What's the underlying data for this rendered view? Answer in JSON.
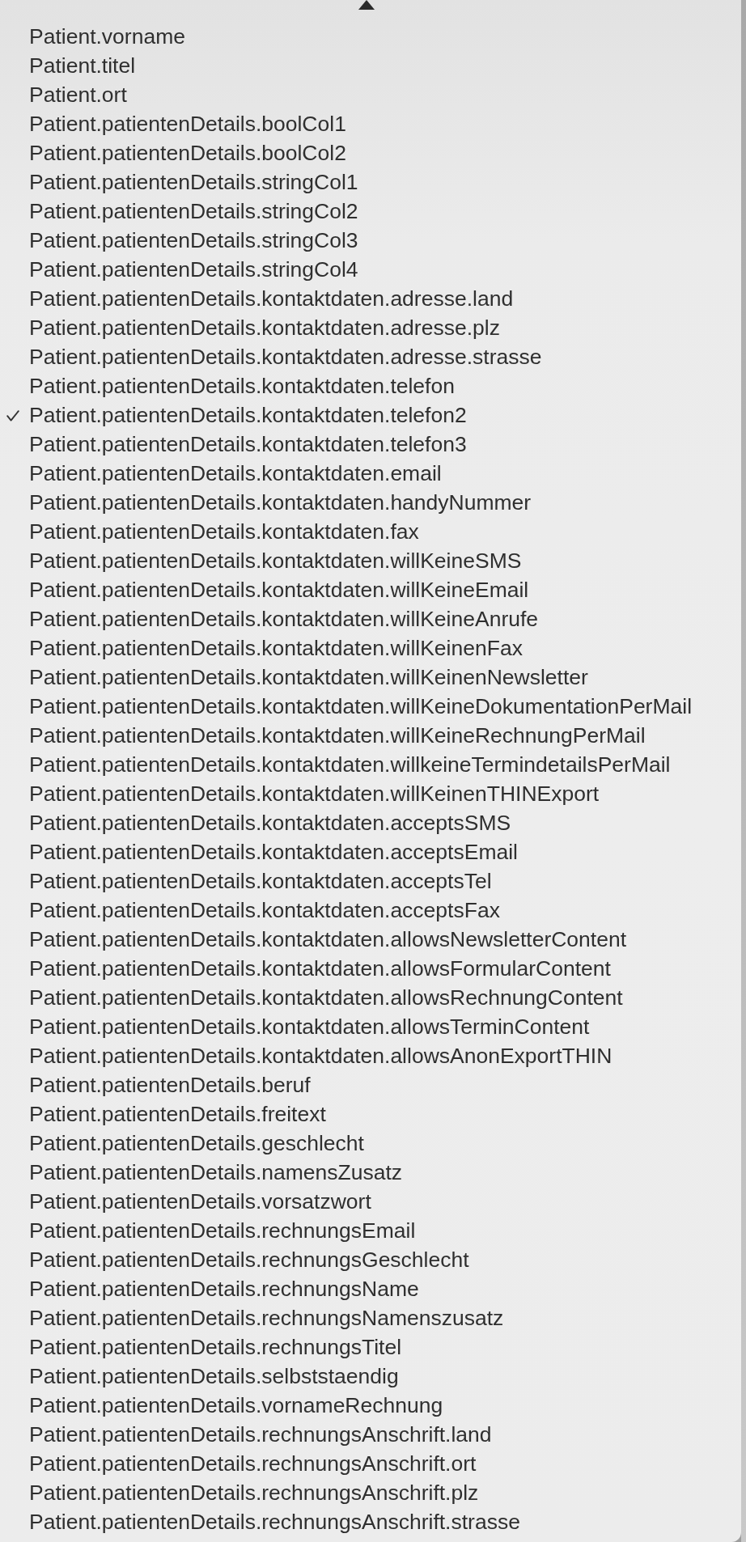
{
  "menu": {
    "items": [
      {
        "label": "Patient.vorname",
        "checked": false
      },
      {
        "label": "Patient.titel",
        "checked": false
      },
      {
        "label": "Patient.ort",
        "checked": false
      },
      {
        "label": "Patient.patientenDetails.boolCol1",
        "checked": false
      },
      {
        "label": "Patient.patientenDetails.boolCol2",
        "checked": false
      },
      {
        "label": "Patient.patientenDetails.stringCol1",
        "checked": false
      },
      {
        "label": "Patient.patientenDetails.stringCol2",
        "checked": false
      },
      {
        "label": "Patient.patientenDetails.stringCol3",
        "checked": false
      },
      {
        "label": "Patient.patientenDetails.stringCol4",
        "checked": false
      },
      {
        "label": "Patient.patientenDetails.kontaktdaten.adresse.land",
        "checked": false
      },
      {
        "label": "Patient.patientenDetails.kontaktdaten.adresse.plz",
        "checked": false
      },
      {
        "label": "Patient.patientenDetails.kontaktdaten.adresse.strasse",
        "checked": false
      },
      {
        "label": "Patient.patientenDetails.kontaktdaten.telefon",
        "checked": false
      },
      {
        "label": "Patient.patientenDetails.kontaktdaten.telefon2",
        "checked": true
      },
      {
        "label": "Patient.patientenDetails.kontaktdaten.telefon3",
        "checked": false
      },
      {
        "label": "Patient.patientenDetails.kontaktdaten.email",
        "checked": false
      },
      {
        "label": "Patient.patientenDetails.kontaktdaten.handyNummer",
        "checked": false
      },
      {
        "label": "Patient.patientenDetails.kontaktdaten.fax",
        "checked": false
      },
      {
        "label": "Patient.patientenDetails.kontaktdaten.willKeineSMS",
        "checked": false
      },
      {
        "label": "Patient.patientenDetails.kontaktdaten.willKeineEmail",
        "checked": false
      },
      {
        "label": "Patient.patientenDetails.kontaktdaten.willKeineAnrufe",
        "checked": false
      },
      {
        "label": "Patient.patientenDetails.kontaktdaten.willKeinenFax",
        "checked": false
      },
      {
        "label": "Patient.patientenDetails.kontaktdaten.willKeinenNewsletter",
        "checked": false
      },
      {
        "label": "Patient.patientenDetails.kontaktdaten.willKeineDokumentationPerMail",
        "checked": false
      },
      {
        "label": "Patient.patientenDetails.kontaktdaten.willKeineRechnungPerMail",
        "checked": false
      },
      {
        "label": "Patient.patientenDetails.kontaktdaten.willkeineTermindetailsPerMail",
        "checked": false
      },
      {
        "label": "Patient.patientenDetails.kontaktdaten.willKeinenTHINExport",
        "checked": false
      },
      {
        "label": "Patient.patientenDetails.kontaktdaten.acceptsSMS",
        "checked": false
      },
      {
        "label": "Patient.patientenDetails.kontaktdaten.acceptsEmail",
        "checked": false
      },
      {
        "label": "Patient.patientenDetails.kontaktdaten.acceptsTel",
        "checked": false
      },
      {
        "label": "Patient.patientenDetails.kontaktdaten.acceptsFax",
        "checked": false
      },
      {
        "label": "Patient.patientenDetails.kontaktdaten.allowsNewsletterContent",
        "checked": false
      },
      {
        "label": "Patient.patientenDetails.kontaktdaten.allowsFormularContent",
        "checked": false
      },
      {
        "label": "Patient.patientenDetails.kontaktdaten.allowsRechnungContent",
        "checked": false
      },
      {
        "label": "Patient.patientenDetails.kontaktdaten.allowsTerminContent",
        "checked": false
      },
      {
        "label": "Patient.patientenDetails.kontaktdaten.allowsAnonExportTHIN",
        "checked": false
      },
      {
        "label": "Patient.patientenDetails.beruf",
        "checked": false
      },
      {
        "label": "Patient.patientenDetails.freitext",
        "checked": false
      },
      {
        "label": "Patient.patientenDetails.geschlecht",
        "checked": false
      },
      {
        "label": "Patient.patientenDetails.namensZusatz",
        "checked": false
      },
      {
        "label": "Patient.patientenDetails.vorsatzwort",
        "checked": false
      },
      {
        "label": "Patient.patientenDetails.rechnungsEmail",
        "checked": false
      },
      {
        "label": "Patient.patientenDetails.rechnungsGeschlecht",
        "checked": false
      },
      {
        "label": "Patient.patientenDetails.rechnungsName",
        "checked": false
      },
      {
        "label": "Patient.patientenDetails.rechnungsNamenszusatz",
        "checked": false
      },
      {
        "label": "Patient.patientenDetails.rechnungsTitel",
        "checked": false
      },
      {
        "label": "Patient.patientenDetails.selbststaendig",
        "checked": false
      },
      {
        "label": "Patient.patientenDetails.vornameRechnung",
        "checked": false
      },
      {
        "label": "Patient.patientenDetails.rechnungsAnschrift.land",
        "checked": false
      },
      {
        "label": "Patient.patientenDetails.rechnungsAnschrift.ort",
        "checked": false
      },
      {
        "label": "Patient.patientenDetails.rechnungsAnschrift.plz",
        "checked": false
      },
      {
        "label": "Patient.patientenDetails.rechnungsAnschrift.strasse",
        "checked": false
      }
    ]
  }
}
